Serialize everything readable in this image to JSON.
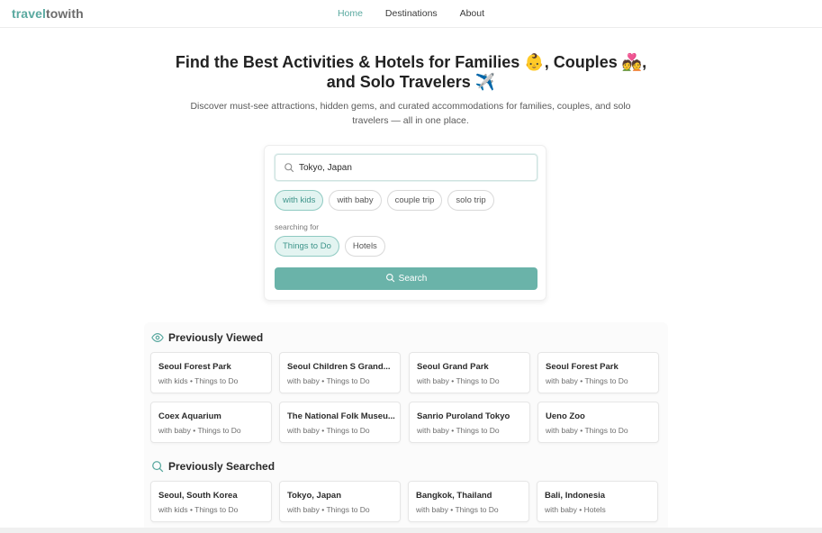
{
  "brand": {
    "part1": "travel",
    "part2": "towith"
  },
  "nav": {
    "home": "Home",
    "destinations": "Destinations",
    "about": "About"
  },
  "hero": {
    "title": "Find the Best Activities & Hotels for Families 👶, Couples 💑, and Solo Travelers ✈️",
    "subtitle": "Discover must-see attractions, hidden gems, and curated accommodations for families, couples, and solo travelers — all in one place."
  },
  "search": {
    "value": "Tokyo, Japan",
    "companions": [
      "with kids",
      "with baby",
      "couple trip",
      "solo trip"
    ],
    "selected_companion": "with kids",
    "searching_for_label": "searching for",
    "types": [
      "Things to Do",
      "Hotels"
    ],
    "selected_type": "Things to Do",
    "button_label": "Search"
  },
  "previously_viewed": {
    "title": "Previously Viewed",
    "items": [
      {
        "name": "Seoul Forest Park",
        "meta": "with kids • Things to Do"
      },
      {
        "name": "Seoul Children S Grand...",
        "meta": "with baby • Things to Do"
      },
      {
        "name": "Seoul Grand Park",
        "meta": "with baby • Things to Do"
      },
      {
        "name": "Seoul Forest Park",
        "meta": "with baby • Things to Do"
      },
      {
        "name": "Coex Aquarium",
        "meta": "with baby • Things to Do"
      },
      {
        "name": "The National Folk Museu...",
        "meta": "with baby • Things to Do"
      },
      {
        "name": "Sanrio Puroland Tokyo",
        "meta": "with baby • Things to Do"
      },
      {
        "name": "Ueno Zoo",
        "meta": "with baby • Things to Do"
      }
    ]
  },
  "previously_searched": {
    "title": "Previously Searched",
    "items": [
      {
        "name": "Seoul, South Korea",
        "meta": "with kids • Things to Do"
      },
      {
        "name": "Tokyo, Japan",
        "meta": "with baby • Things to Do"
      },
      {
        "name": "Bangkok, Thailand",
        "meta": "with baby • Things to Do"
      },
      {
        "name": "Bali, Indonesia",
        "meta": "with baby • Hotels"
      }
    ]
  },
  "colors": {
    "accent": "#5aa9a0",
    "button": "#6ab3a9",
    "chip_selected_bg": "#e3f4f1"
  },
  "icons": {
    "search": "search-icon",
    "viewed": "eye-icon",
    "searched": "search-icon"
  }
}
